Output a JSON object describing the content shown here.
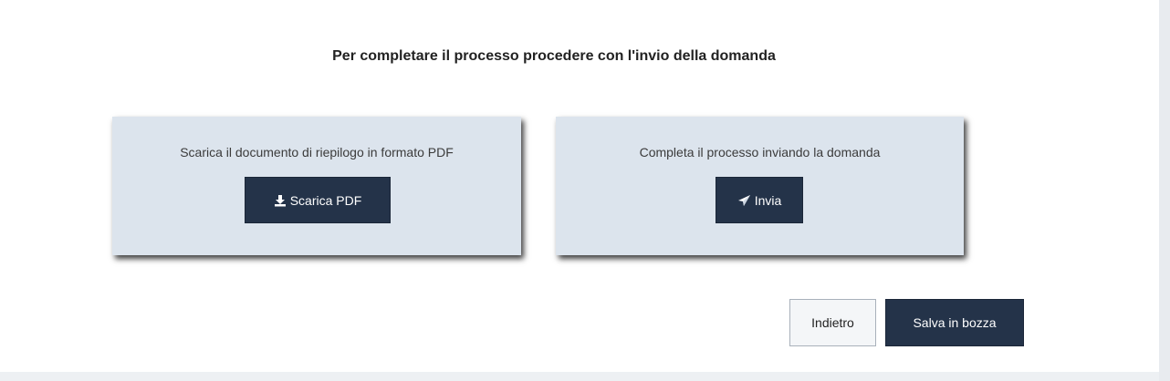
{
  "heading": "Per completare il processo procedere con l'invio della domanda",
  "download_card": {
    "text": "Scarica il documento di riepilogo in formato PDF",
    "button_label": "Scarica PDF",
    "button_icon": "download-icon"
  },
  "send_card": {
    "text": "Completa il processo inviando la domanda",
    "button_label": "Invia",
    "button_icon": "send-icon"
  },
  "footer": {
    "back_label": "Indietro",
    "draft_label": "Salva in bozza"
  },
  "colors": {
    "card_background": "#dce4ed",
    "primary_button": "#243349",
    "secondary_button": "#f4f6f8"
  }
}
